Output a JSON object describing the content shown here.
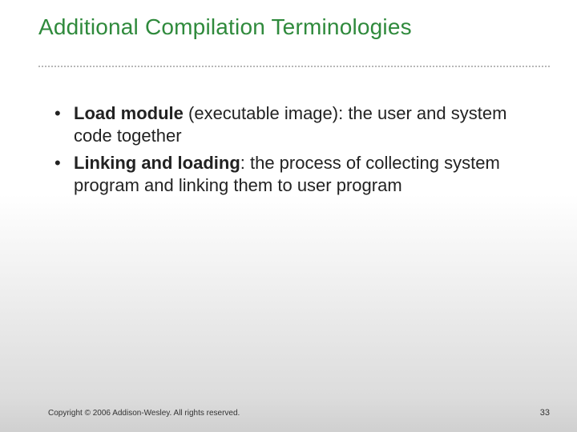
{
  "slide": {
    "title": "Additional Compilation Terminologies",
    "bullets": [
      {
        "term": "Load module",
        "rest": " (executable image): the user and system code together"
      },
      {
        "term": "Linking and loading",
        "rest": ": the process of collecting system program and linking them to user program"
      }
    ],
    "footer": {
      "copyright": "Copyright © 2006 Addison-Wesley. All rights reserved.",
      "page": "33"
    }
  }
}
